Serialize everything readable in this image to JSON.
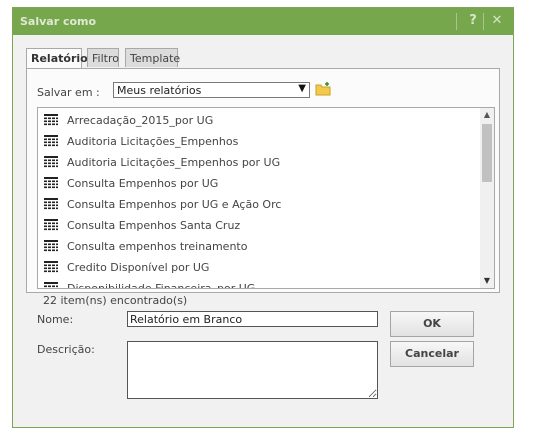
{
  "dialog": {
    "title": "Salvar como",
    "help_icon": "question-icon",
    "close_icon": "close-icon",
    "help_label": "?",
    "close_label": "✕"
  },
  "tabs": [
    {
      "label": "Relatório",
      "active": true
    },
    {
      "label": "Filtro",
      "active": false
    },
    {
      "label": "Template",
      "active": false
    }
  ],
  "save_in": {
    "label": "Salvar em :",
    "selected": "Meus relatórios",
    "arrow": "▼"
  },
  "list": {
    "items": [
      "Arrecadação_2015_por UG",
      "Auditoria Licitações_Empenhos",
      "Auditoria Licitações_Empenhos por UG",
      "Consulta Empenhos por UG",
      "Consulta Empenhos por UG e Ação Orc",
      "Consulta Empenhos Santa Cruz",
      "Consulta empenhos treinamento",
      "Credito Disponível por UG",
      "Disponibilidade Financeira_por UG"
    ],
    "count_text": "22 item(ns) encontrado(s)",
    "scroll_up": "▲",
    "scroll_down": "▼"
  },
  "form": {
    "name_label": "Nome:",
    "name_value": "Relatório em Branco",
    "description_label": "Descrição:",
    "description_value": ""
  },
  "buttons": {
    "ok": "OK",
    "cancel": "Cancelar"
  },
  "colors": {
    "titlebar": "#77a74d",
    "folder": "#f2c94c"
  }
}
